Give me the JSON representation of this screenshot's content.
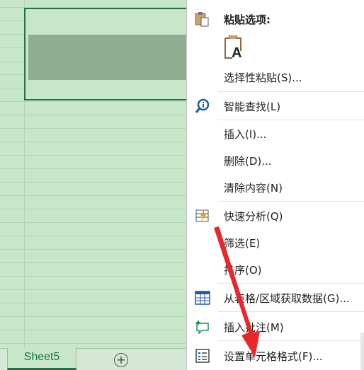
{
  "sheet": {
    "tab_label": "Sheet5",
    "add_sheet_glyph": "+"
  },
  "menu": {
    "paste_options_label": "粘贴选项:",
    "paste_icon_letter": "A",
    "items": [
      {
        "label": "选择性粘贴(S)...",
        "icon": "none"
      },
      {
        "label": "智能查找(L)",
        "icon": "smart-lookup-icon"
      },
      {
        "label": "插入(I)...",
        "icon": "none"
      },
      {
        "label": "删除(D)...",
        "icon": "none"
      },
      {
        "label": "清除内容(N)",
        "icon": "none"
      },
      {
        "label": "快速分析(Q)",
        "icon": "quick-analysis-icon"
      },
      {
        "label": "筛选(E)",
        "icon": "none"
      },
      {
        "label": "排序(O)",
        "icon": "none"
      },
      {
        "label": "从表格/区域获取数据(G)...",
        "icon": "table-icon"
      },
      {
        "label": "插入批注(M)",
        "icon": "insert-comment-icon"
      },
      {
        "label": "设置单元格格式(F)...",
        "icon": "format-cells-icon"
      }
    ]
  },
  "colors": {
    "sheet_bg": "#c8e6c8",
    "selection_border": "#217346",
    "arrow": "#e8262b"
  }
}
